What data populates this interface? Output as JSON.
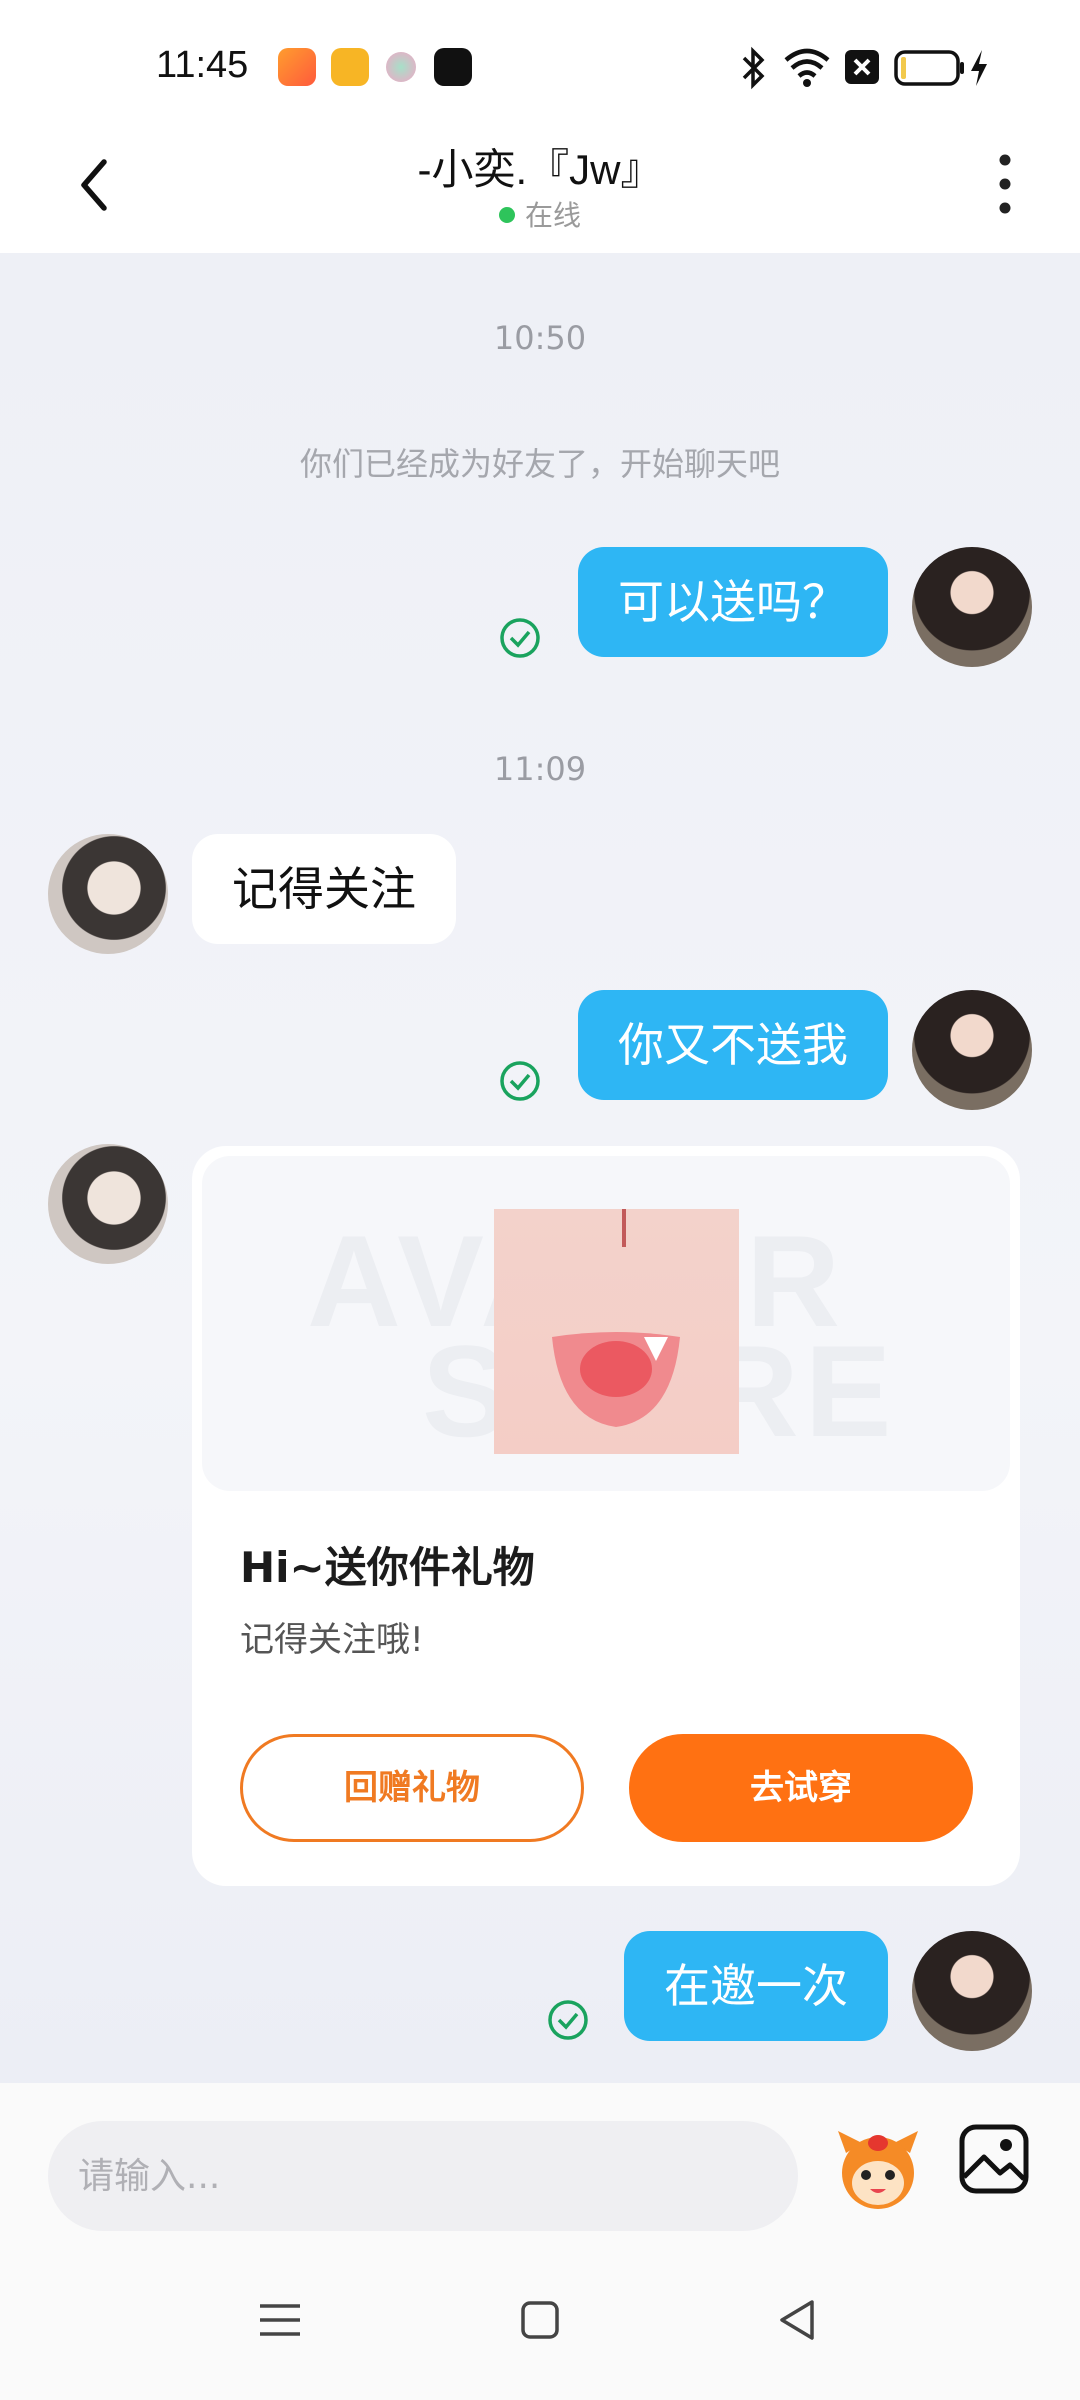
{
  "status_bar": {
    "time": "11:45",
    "icons": [
      "video-app-icon",
      "gift-app-icon",
      "dot-app-icon",
      "capcut-app-icon",
      "bluetooth-icon",
      "wifi-icon",
      "sim-off-icon",
      "battery-icon",
      "charging-icon"
    ],
    "battery_level": 0.05
  },
  "header": {
    "title": "-小奕.『Jw』",
    "online_status": "在线",
    "online_color": "#2ec45b"
  },
  "messages": [
    {
      "type": "time",
      "text": "10:50"
    },
    {
      "type": "system",
      "text": "你们已经成为好友了，开始聊天吧"
    },
    {
      "type": "outgoing",
      "text": "可以送吗？",
      "status": "read"
    },
    {
      "type": "time",
      "text": "11:09"
    },
    {
      "type": "incoming",
      "text": "记得关注"
    },
    {
      "type": "outgoing",
      "text": "你又不送我",
      "status": "read"
    },
    {
      "type": "incoming_gift",
      "watermark_line1": "AVATAR",
      "watermark_line2": "STORE",
      "title": "Hi~送你件礼物",
      "subtitle": "记得关注哦!",
      "return_gift_label": "回赠礼物",
      "try_on_label": "去试穿"
    },
    {
      "type": "outgoing",
      "text": "在邀一次",
      "status": "read"
    }
  ],
  "input": {
    "placeholder": "请输入..."
  },
  "colors": {
    "outgoing_bubble": "#2eb6f4",
    "accent_orange": "#ff7112",
    "read_check": "#1aa35e"
  },
  "nav": [
    "menu-icon",
    "home-icon",
    "back-triangle-icon"
  ]
}
